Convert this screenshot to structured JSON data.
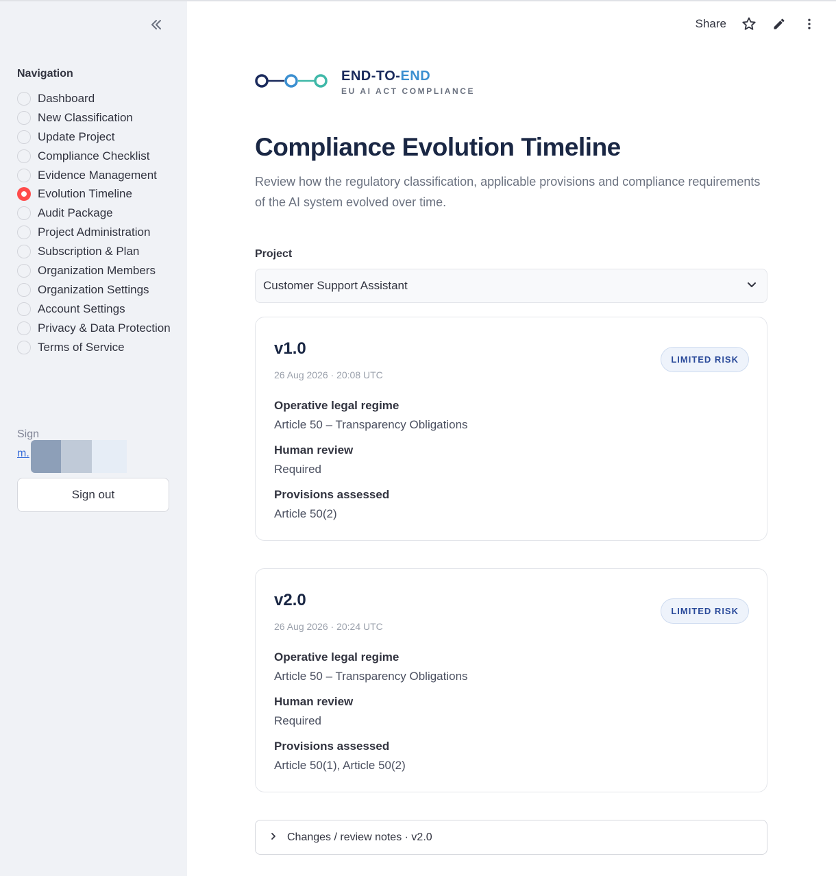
{
  "sidebar": {
    "collapse_icon": "double-chevron-left-icon",
    "nav_title": "Navigation",
    "items": [
      {
        "label": "Dashboard",
        "selected": false
      },
      {
        "label": "New Classification",
        "selected": false
      },
      {
        "label": "Update Project",
        "selected": false
      },
      {
        "label": "Compliance Checklist",
        "selected": false
      },
      {
        "label": "Evidence Management",
        "selected": false
      },
      {
        "label": "Evolution Timeline",
        "selected": true
      },
      {
        "label": "Audit Package",
        "selected": false
      },
      {
        "label": "Project Administration",
        "selected": false
      },
      {
        "label": "Subscription & Plan",
        "selected": false
      },
      {
        "label": "Organization Members",
        "selected": false
      },
      {
        "label": "Organization Settings",
        "selected": false
      },
      {
        "label": "Account Settings",
        "selected": false
      },
      {
        "label": "Privacy & Data Protection",
        "selected": false
      },
      {
        "label": "Terms of Service",
        "selected": false
      }
    ],
    "signed_in_text": "Sign",
    "user_email": "m.",
    "sign_out_label": "Sign out"
  },
  "toolbar": {
    "share_label": "Share",
    "icons": [
      "star-icon",
      "pencil-icon",
      "more-vertical-icon"
    ]
  },
  "logo": {
    "title_part1": "END-TO-",
    "title_part2": "END",
    "subtitle": "EU AI ACT COMPLIANCE",
    "colors": {
      "navy": "#1a2a5c",
      "blue": "#3b8fd0",
      "teal": "#3fb8a8"
    }
  },
  "page": {
    "title": "Compliance Evolution Timeline",
    "description": "Review how the regulatory classification, applicable provisions and compliance requirements of the AI system evolved over time."
  },
  "project_select": {
    "label": "Project",
    "value": "Customer Support Assistant"
  },
  "versions": [
    {
      "version": "v1.0",
      "timestamp": "26 Aug 2026 · 20:08 UTC",
      "risk_badge": "LIMITED RISK",
      "fields": [
        {
          "label": "Operative legal regime",
          "value": "Article 50 – Transparency Obligations"
        },
        {
          "label": "Human review",
          "value": "Required"
        },
        {
          "label": "Provisions assessed",
          "value": "Article 50(2)"
        }
      ]
    },
    {
      "version": "v2.0",
      "timestamp": "26 Aug 2026 · 20:24 UTC",
      "risk_badge": "LIMITED RISK",
      "fields": [
        {
          "label": "Operative legal regime",
          "value": "Article 50 – Transparency Obligations"
        },
        {
          "label": "Human review",
          "value": "Required"
        },
        {
          "label": "Provisions assessed",
          "value": "Article 50(1), Article 50(2)"
        }
      ]
    }
  ],
  "expander": {
    "label": "Changes / review notes · v2.0"
  },
  "colors": {
    "accent": "#ff4b4b",
    "sidebar_bg": "#f0f2f6",
    "link": "#3b6fd9",
    "badge_text": "#2a4a9a"
  }
}
